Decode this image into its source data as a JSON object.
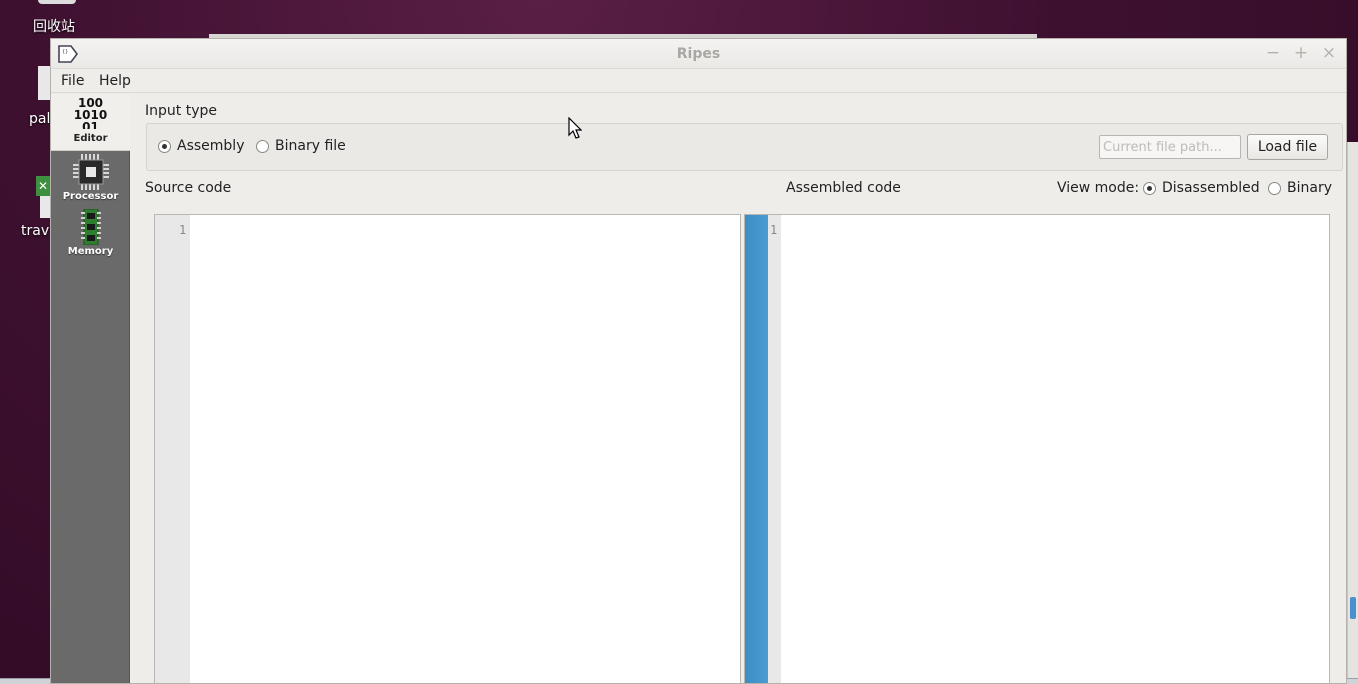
{
  "desktop": {
    "trash_label": "回收站",
    "file1_label": "pal",
    "file2_label": "trav"
  },
  "window": {
    "title": "Ripes",
    "controls": {
      "minimize": "−",
      "maximize": "+",
      "close": "×"
    }
  },
  "menu": {
    "file": "File",
    "help": "Help"
  },
  "tabs": {
    "editor": {
      "glyph_lines": [
        "100",
        "1010",
        "01"
      ],
      "label": "Editor"
    },
    "processor": {
      "label": "Processor"
    },
    "memory": {
      "label": "Memory"
    }
  },
  "input": {
    "title": "Input type",
    "assembly_label": "Assembly",
    "binary_file_label": "Binary file",
    "assembly_selected": true,
    "file_path_value": "",
    "file_path_placeholder": "Current file path...",
    "load_button": "Load file"
  },
  "source": {
    "title": "Source code",
    "line_numbers": [
      "1"
    ]
  },
  "assembled": {
    "title": "Assembled code",
    "view_mode_label": "View mode:",
    "disassembled_label": "Disassembled",
    "binary_label": "Binary",
    "disassembled_selected": true,
    "line_numbers": [
      "1"
    ]
  },
  "colors": {
    "desktop_bg": "#3e1030",
    "window_bg": "#efedea",
    "tabbar_bg": "#6a6a6a",
    "breakpoint_bar": "#4a9bd0"
  }
}
